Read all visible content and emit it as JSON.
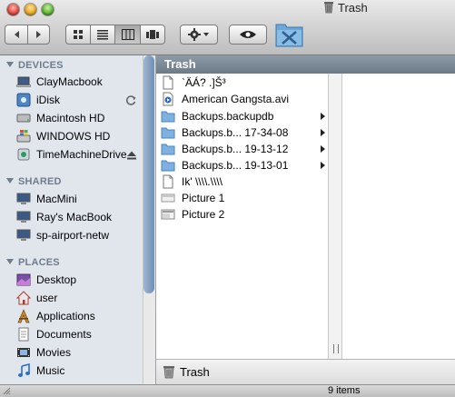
{
  "window": {
    "title": "Trash"
  },
  "toolbar": {
    "nav": [
      "back",
      "forward"
    ],
    "view_modes": [
      "icon-view",
      "list-view",
      "column-view",
      "cover-flow"
    ],
    "active_view": "column-view",
    "action_icon": "gear-icon",
    "quicklook_icon": "eye-icon",
    "custom_icon": "tools-icon"
  },
  "sidebar": {
    "sections": [
      {
        "title": "DEVICES",
        "items": [
          {
            "label": "ClayMacbook",
            "icon": "laptop-icon"
          },
          {
            "label": "iDisk",
            "icon": "idisk-icon",
            "accessory": "sync-icon"
          },
          {
            "label": "Macintosh HD",
            "icon": "harddisk-icon"
          },
          {
            "label": "WINDOWS HD",
            "icon": "windows-disk-icon"
          },
          {
            "label": "TimeMachineDrive",
            "icon": "external-disk-icon",
            "accessory": "eject-icon"
          }
        ]
      },
      {
        "title": "SHARED",
        "items": [
          {
            "label": "MacMini",
            "icon": "network-computer-icon"
          },
          {
            "label": "Ray's MacBook",
            "icon": "network-computer-icon"
          },
          {
            "label": "sp-airport-netw",
            "icon": "network-computer-icon"
          }
        ]
      },
      {
        "title": "PLACES",
        "items": [
          {
            "label": "Desktop",
            "icon": "desktop-icon"
          },
          {
            "label": "user",
            "icon": "home-icon"
          },
          {
            "label": "Applications",
            "icon": "applications-icon"
          },
          {
            "label": "Documents",
            "icon": "documents-icon"
          },
          {
            "label": "Movies",
            "icon": "movies-icon"
          },
          {
            "label": "Music",
            "icon": "music-icon"
          }
        ]
      }
    ]
  },
  "column": {
    "header": "Trash",
    "items": [
      {
        "name": " `ÄÁ? .]Š³",
        "type": "document",
        "has_children": false
      },
      {
        "name": "American Gangsta.avi",
        "type": "video",
        "has_children": false
      },
      {
        "name": "Backups.backupdb",
        "type": "folder",
        "has_children": true
      },
      {
        "name": "Backups.b... 17-34-08",
        "type": "folder",
        "has_children": true
      },
      {
        "name": "Backups.b... 19-13-12",
        "type": "folder",
        "has_children": true
      },
      {
        "name": "Backups.b... 19-13-01",
        "type": "folder",
        "has_children": true
      },
      {
        "name": "Ik' \\\\\\\\.\\\\\\\\",
        "type": "document",
        "has_children": false
      },
      {
        "name": "Picture 1",
        "type": "image",
        "has_children": false
      },
      {
        "name": "Picture 2",
        "type": "image",
        "has_children": false
      }
    ]
  },
  "pathbar": {
    "label": "Trash"
  },
  "status": {
    "text": "9 items"
  },
  "colors": {
    "sidebar_bg": "#e1e6ed",
    "header_bg": "#7a8795",
    "section_title": "#6f7c8c"
  }
}
